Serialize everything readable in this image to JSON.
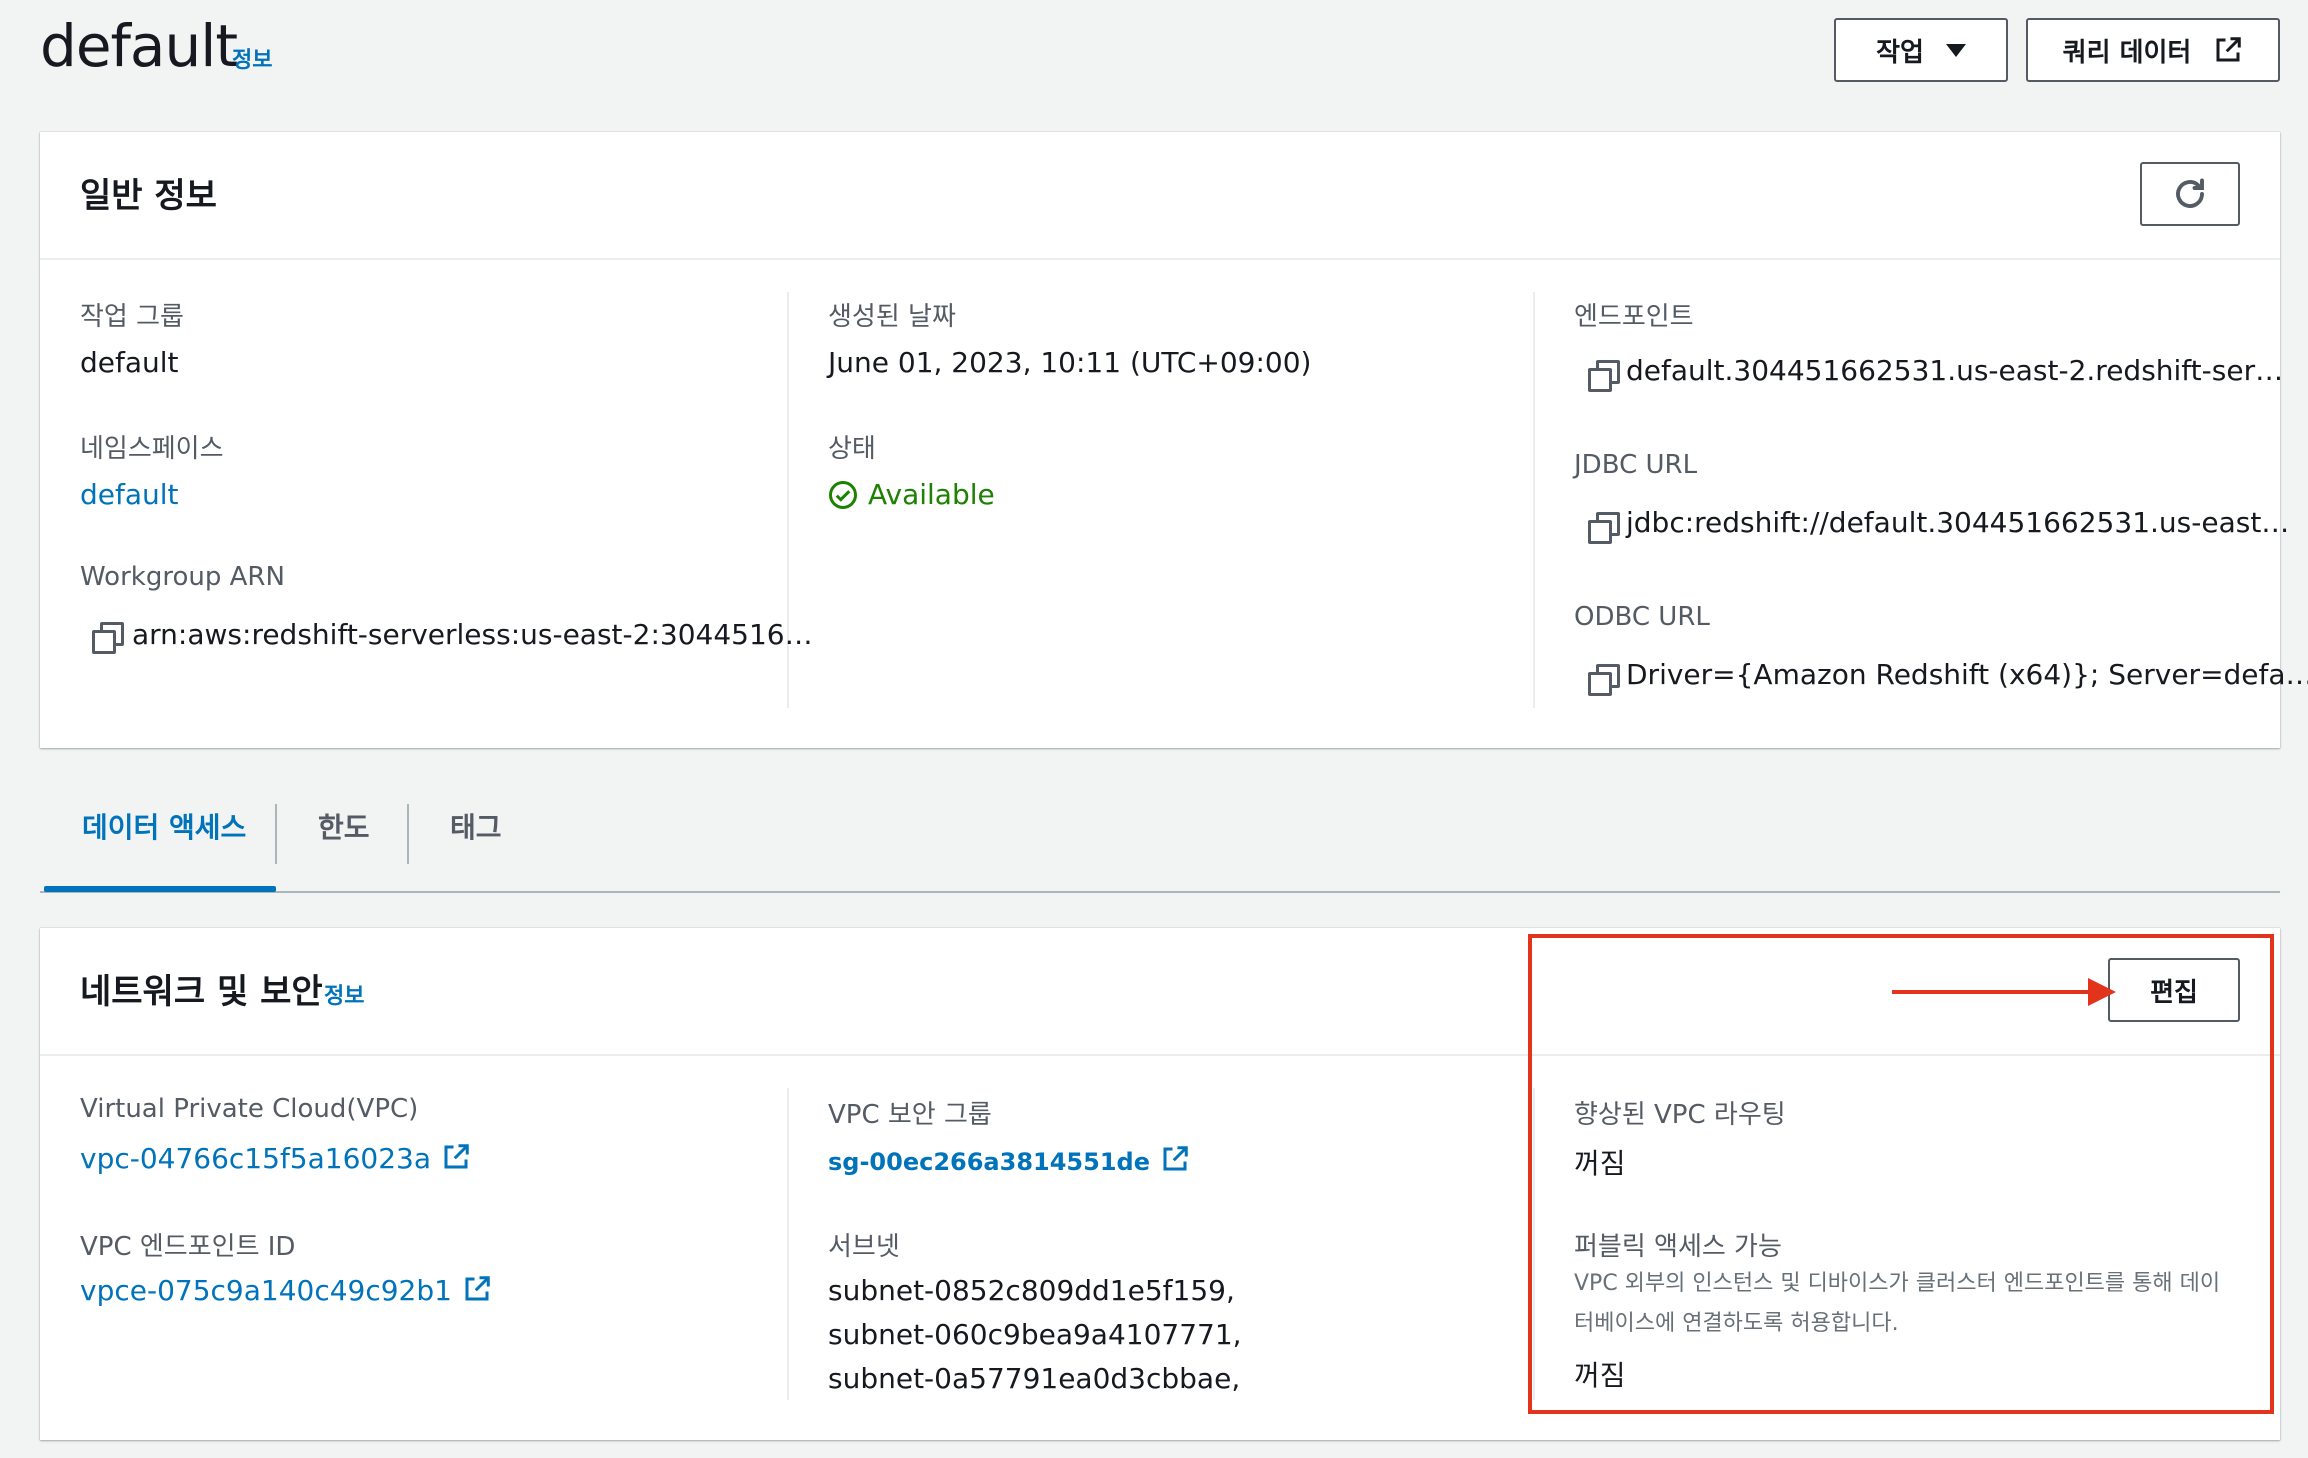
{
  "header": {
    "title": "default",
    "info_label": "정보",
    "actions_button": "작업",
    "query_button": "쿼리 데이터"
  },
  "general": {
    "title": "일반 정보",
    "workgroup_label": "작업 그룹",
    "workgroup_value": "default",
    "namespace_label": "네임스페이스",
    "namespace_value": "default",
    "arn_label": "Workgroup ARN",
    "arn_value": "arn:aws:redshift-serverless:us-east-2:3044516…",
    "created_label": "생성된 날짜",
    "created_value": "June 01, 2023, 10:11 (UTC+09:00)",
    "status_label": "상태",
    "status_value": "Available",
    "endpoint_label": "엔드포인트",
    "endpoint_value": "default.304451662531.us-east-2.redshift-ser…",
    "jdbc_label": "JDBC URL",
    "jdbc_value": "jdbc:redshift://default.304451662531.us-east…",
    "odbc_label": "ODBC URL",
    "odbc_value": "Driver={Amazon Redshift (x64)}; Server=defa…"
  },
  "tabs": [
    {
      "label": "데이터 액세스"
    },
    {
      "label": "한도"
    },
    {
      "label": "태그"
    }
  ],
  "network": {
    "title": "네트워크 및 보안",
    "info_label": "정보",
    "edit_button": "편집",
    "vpc_label": "Virtual Private Cloud(VPC)",
    "vpc_value": "vpc-04766c15f5a16023a",
    "vpce_label": "VPC 엔드포인트 ID",
    "vpce_value": "vpce-075c9a140c49c92b1",
    "sg_label": "VPC 보안 그룹",
    "sg_value": "sg-00ec266a3814551de",
    "subnet_label": "서브넷",
    "subnets": [
      "subnet-0852c809dd1e5f159,",
      "subnet-060c9bea9a4107771,",
      "subnet-0a57791ea0d3cbbae,"
    ],
    "enhanced_label": "향상된 VPC 라우팅",
    "enhanced_value": "꺼짐",
    "public_label": "퍼블릭 액세스 가능",
    "public_desc_1": "VPC 외부의 인스턴스 및 디바이스가 클러스터 엔드포인트를 통해 데이",
    "public_desc_2": "터베이스에 연결하도록 허용합니다.",
    "public_value": "꺼짐"
  },
  "colors": {
    "link": "#0073bb",
    "success": "#1d8102",
    "annotation": "#e2341d"
  }
}
